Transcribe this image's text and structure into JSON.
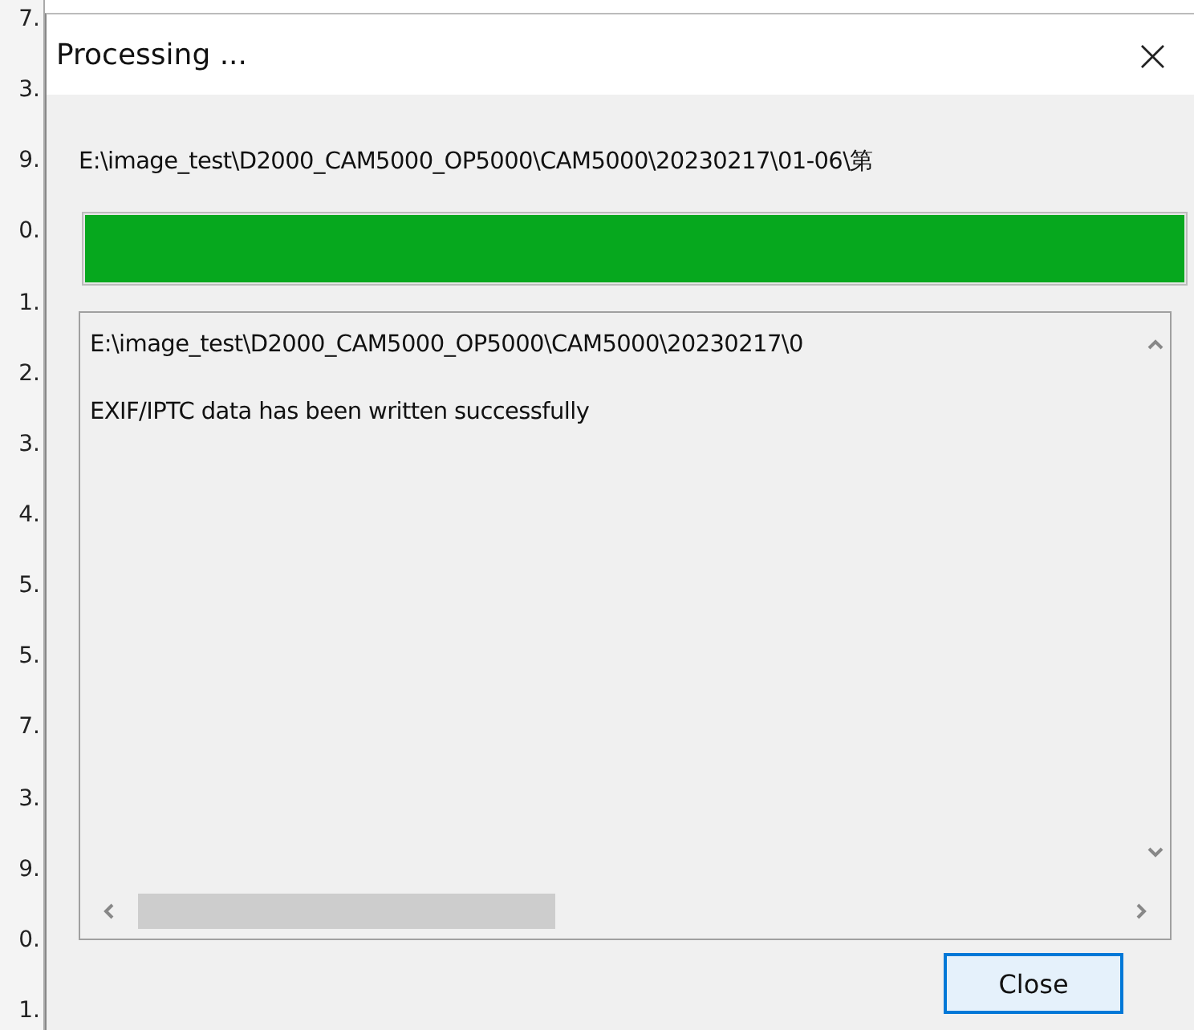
{
  "background_window": {
    "row_fragments": [
      "7.",
      "3.",
      "9.",
      "0.",
      "1.",
      "2.",
      "3.",
      "4.",
      "5.",
      "5.",
      "7.",
      "3.",
      "9.",
      "0.",
      "1."
    ]
  },
  "window": {
    "title": "Processing ...",
    "close_glyph": "×"
  },
  "current_file": "E:\\image_test\\D2000_CAM5000_OP5000\\CAM5000\\20230217\\01-06\\第",
  "progress": {
    "level": 1
  },
  "log": {
    "lines": [
      "E:\\image_test\\D2000_CAM5000_OP5000\\CAM5000\\20230217\\0",
      "EXIF/IPTC data has been written successfully"
    ]
  },
  "buttons": [
    {
      "label": "Close",
      "selected": true
    }
  ]
}
